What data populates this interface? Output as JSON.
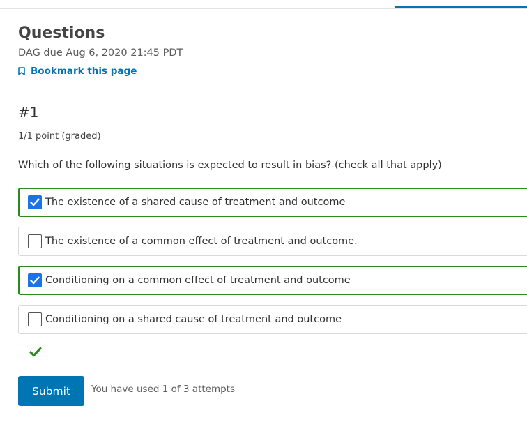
{
  "header": {
    "title": "Questions",
    "due": "DAG due Aug 6, 2020 21:45 PDT",
    "bookmark_label": "Bookmark this page"
  },
  "problem": {
    "number": "#1",
    "points": "1/1 point (graded)",
    "prompt": "Which of the following situations is expected to result in bias? (check all that apply)",
    "choices": [
      {
        "label": "The existence of a shared cause of treatment and outcome",
        "checked": true
      },
      {
        "label": "The existence of a common effect of treatment and outcome.",
        "checked": false
      },
      {
        "label": "Conditioning on a common effect of treatment and outcome",
        "checked": true
      },
      {
        "label": "Conditioning on a shared cause of treatment and outcome",
        "checked": false
      }
    ],
    "status_icon": "checkmark-icon"
  },
  "actions": {
    "submit_label": "Submit",
    "attempts_text": "You have used 1 of 3 attempts"
  },
  "colors": {
    "accent": "#0075b4",
    "correct": "#2b8a1f",
    "checkbox_checked": "#1a73e8"
  }
}
